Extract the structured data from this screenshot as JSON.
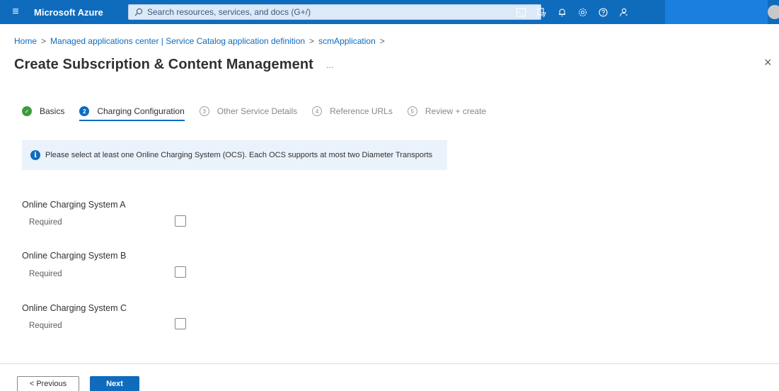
{
  "topbar": {
    "menu_icon": "hamburger-icon",
    "brand": "Microsoft Azure",
    "search_placeholder": "Search resources, services, and docs (G+/)",
    "icons": [
      "cloud-shell-icon",
      "directory-filter-icon",
      "notifications-icon",
      "settings-icon",
      "help-icon",
      "feedback-icon"
    ]
  },
  "breadcrumb": {
    "items": [
      "Home",
      "Managed applications center | Service Catalog application definition",
      "scmApplication"
    ],
    "separator": ">"
  },
  "page": {
    "title": "Create Subscription & Content Management",
    "more": "...",
    "close": "×"
  },
  "wizard": {
    "steps": [
      {
        "number": "✓",
        "label": "Basics",
        "state": "done"
      },
      {
        "number": "2",
        "label": "Charging Configuration",
        "state": "active"
      },
      {
        "number": "3",
        "label": "Other Service Details",
        "state": "todo"
      },
      {
        "number": "4",
        "label": "Reference URLs",
        "state": "todo"
      },
      {
        "number": "5",
        "label": "Review + create",
        "state": "todo"
      }
    ]
  },
  "info": {
    "icon": "info-icon",
    "text": "Please select at least one Online Charging System (OCS). Each OCS supports at most two Diameter Transports"
  },
  "ocs": [
    {
      "label": "Online Charging System A",
      "required": "Required",
      "checked": false
    },
    {
      "label": "Online Charging System B",
      "required": "Required",
      "checked": false
    },
    {
      "label": "Online Charging System C",
      "required": "Required",
      "checked": false
    }
  ],
  "footer": {
    "previous": "< Previous",
    "next": "Next"
  },
  "colors": {
    "accent": "#0f6cbd",
    "success": "#3d9b3d",
    "info_bg": "#eaf2fb"
  }
}
